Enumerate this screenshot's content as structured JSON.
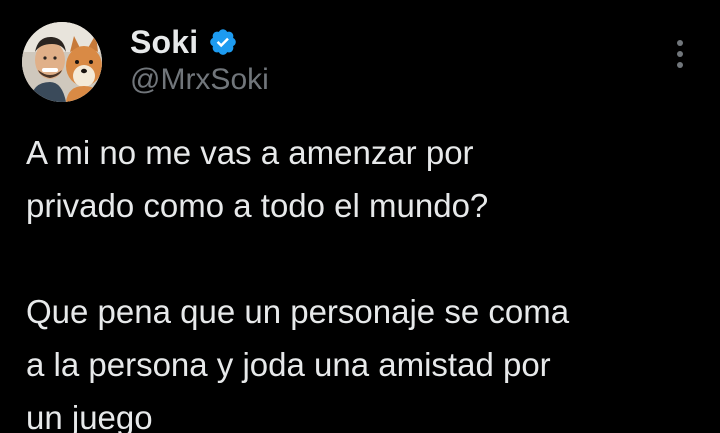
{
  "author": {
    "display_name": "Soki",
    "handle": "@MrxSoki",
    "verified": true
  },
  "icons": {
    "verified": "verified-badge-icon",
    "more": "more-options-icon",
    "avatar": "profile-avatar"
  },
  "tweet": {
    "paragraph_1_line_1": "A mi no me vas a amenzar por",
    "paragraph_1_line_2": "privado como a todo el mundo?",
    "paragraph_2_line_1": "Que pena que un personaje se coma",
    "paragraph_2_line_2": "a la persona y joda una amistad por",
    "paragraph_2_line_3": "un juego"
  },
  "colors": {
    "background": "#000000",
    "text_primary": "#e7e9ea",
    "text_secondary": "#71767b",
    "verified_blue": "#1d9bf0"
  }
}
